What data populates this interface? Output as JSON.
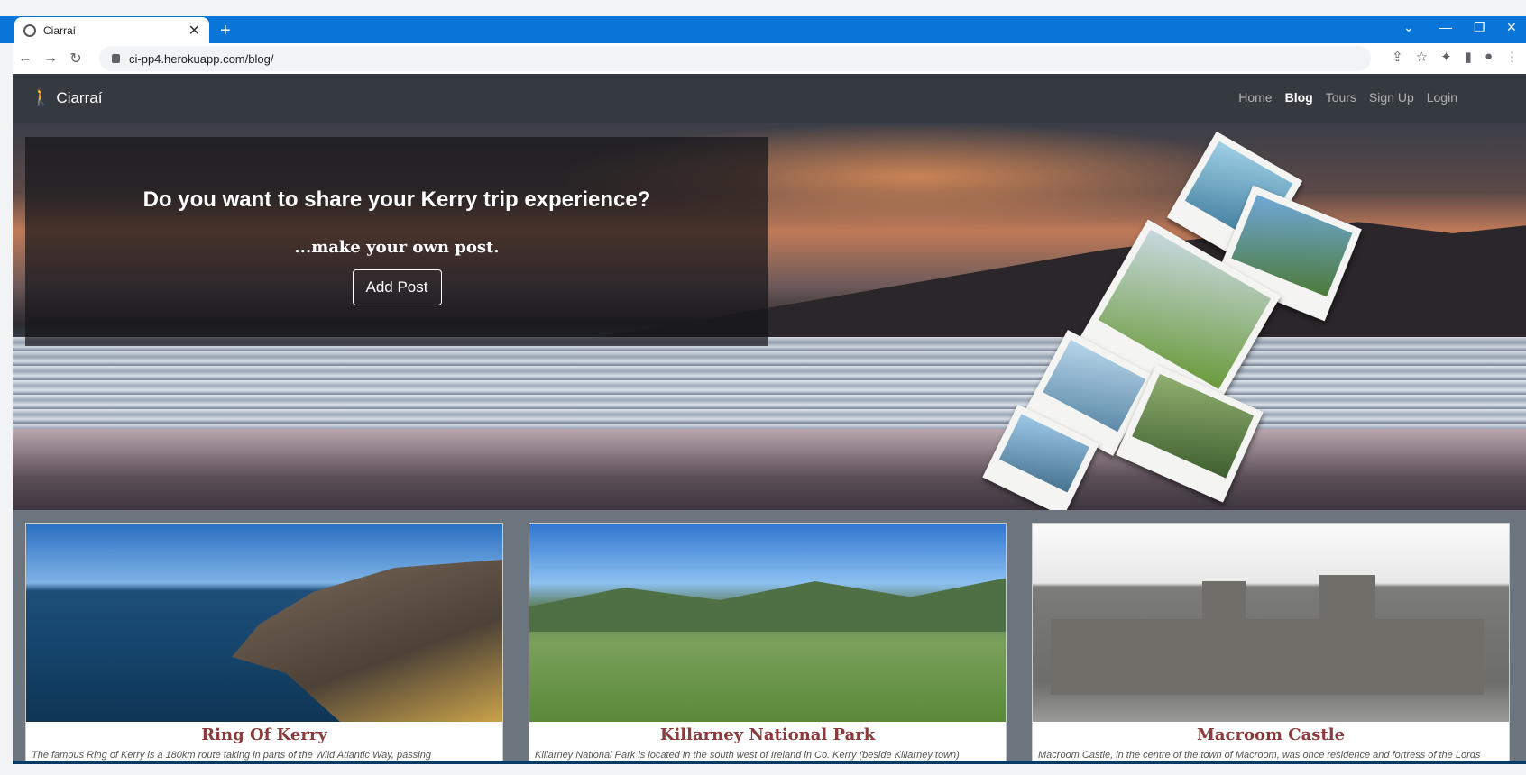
{
  "browser": {
    "tab_title": "Ciarraí",
    "url": "ci-pp4.herokuapp.com/blog/",
    "new_tab": "+",
    "tab_close": "✕"
  },
  "site": {
    "brand": "Ciarraí",
    "nav": [
      {
        "label": "Home"
      },
      {
        "label": "Blog"
      },
      {
        "label": "Tours"
      },
      {
        "label": "Sign Up"
      },
      {
        "label": "Login"
      }
    ]
  },
  "hero": {
    "title": "Do you want to share your Kerry trip experience?",
    "subtitle": "...make your own post.",
    "button": "Add Post"
  },
  "cards": [
    {
      "title": "Ring Of Kerry",
      "excerpt": "The famous Ring of Kerry is a 180km route taking in parts of the Wild Atlantic Way, passing"
    },
    {
      "title": "Killarney National Park",
      "excerpt": "Killarney National Park is located in the south west of Ireland in Co. Kerry (beside Killarney town)"
    },
    {
      "title": "Macroom Castle",
      "excerpt": "Macroom Castle, in the centre of the town of Macroom, was once residence and fortress of the Lords"
    }
  ],
  "icons": {
    "back": "←",
    "forward": "→",
    "reload": "↻",
    "share": "⇪",
    "star": "☆",
    "puzzle": "✦",
    "sidepanel": "▮",
    "profile": "●",
    "menu": "⋮",
    "minimize": "—",
    "restore": "❐",
    "close": "✕",
    "chevron": "⌄"
  }
}
